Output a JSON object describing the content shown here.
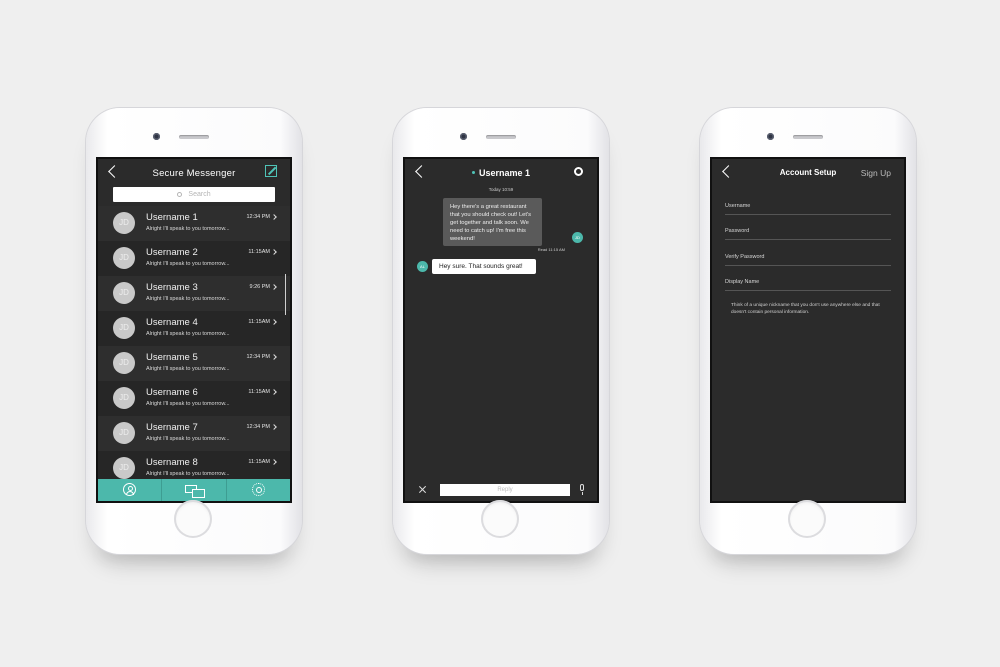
{
  "phone1": {
    "title": "Secure Messenger",
    "search_placeholder": "Search",
    "conversations": [
      {
        "avatar": "JD",
        "username": "Username 1",
        "time": "12:34 PM",
        "preview": "Alright I'll speak to you tomorrow..."
      },
      {
        "avatar": "JD",
        "username": "Username 2",
        "time": "11:15AM",
        "preview": "Alright I'll speak to you tomorrow..."
      },
      {
        "avatar": "JD",
        "username": "Username 3",
        "time": "9:26 PM",
        "preview": "Alright I'll speak to you tomorrow..."
      },
      {
        "avatar": "JD",
        "username": "Username 4",
        "time": "11:15AM",
        "preview": "Alright I'll speak to you tomorrow..."
      },
      {
        "avatar": "JD",
        "username": "Username 5",
        "time": "12:34 PM",
        "preview": "Alright I'll speak to you tomorrow..."
      },
      {
        "avatar": "JD",
        "username": "Username 6",
        "time": "11:15AM",
        "preview": "Alright I'll speak to you tomorrow..."
      },
      {
        "avatar": "JD",
        "username": "Username 7",
        "time": "12:34 PM",
        "preview": "Alright I'll speak to you tomorrow..."
      },
      {
        "avatar": "JD",
        "username": "Username 8",
        "time": "11:15AM",
        "preview": "Alright I'll speak to you tomorrow..."
      }
    ],
    "tabs": [
      "person-icon",
      "chat-icon",
      "gear-icon"
    ],
    "accent": "#4cb8ab"
  },
  "phone2": {
    "title": "Username 1",
    "date_label": "Today 10:59",
    "outgoing_message": "Hey there's a great restaurant that you should check out! Let's get together and talk soon. We need to catch up! I'm free this weekend!",
    "outgoing_avatar": "JD",
    "read_receipt": "Read 11:15 AM",
    "incoming_message": "Hey sure. That sounds great!",
    "incoming_avatar": "AL",
    "reply_placeholder": "Reply"
  },
  "phone3": {
    "title": "Account Setup",
    "action": "Sign Up",
    "fields": [
      "Username",
      "Password",
      "Verify Password",
      "Display Name"
    ],
    "hint": "Think of a unique nickname that you don't use anywhere else and that doesn't contain personal information."
  }
}
